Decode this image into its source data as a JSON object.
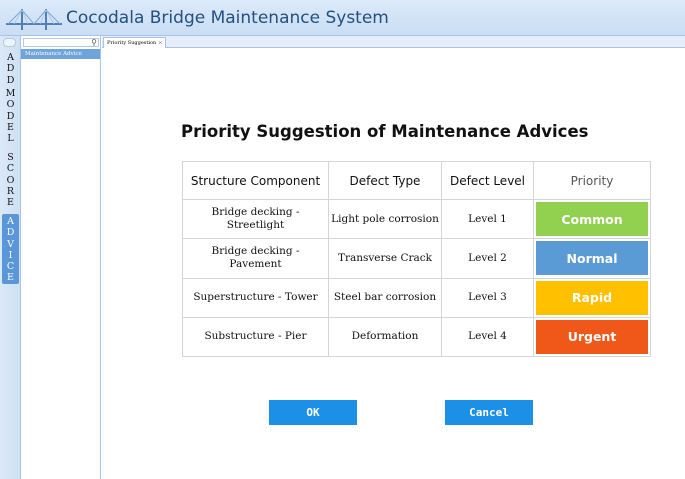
{
  "app": {
    "title": "Cocodala Bridge Maintenance System",
    "logo_icon": "bridge-logo-icon"
  },
  "nav": {
    "items": [
      {
        "label": "ADD",
        "active": false
      },
      {
        "label": "MODEL",
        "active": false
      },
      {
        "label": "SCORE",
        "active": false
      },
      {
        "label": "ADVICE",
        "active": true
      }
    ]
  },
  "tree": {
    "search_icon": "search-icon",
    "selected_item": "Maintenance Advice"
  },
  "tabs": [
    {
      "label": "Priority Suggestion",
      "close": "×"
    }
  ],
  "page": {
    "heading": "Priority Suggestion of Maintenance Advices"
  },
  "table": {
    "headers": [
      "Structure Component",
      "Defect Type",
      "Defect Level",
      "Priority"
    ],
    "rows": [
      {
        "component": "Bridge decking - Streetlight",
        "defect": "Light pole corrosion",
        "level": "Level 1",
        "priority": "Common",
        "color": "#92d050"
      },
      {
        "component": "Bridge decking - Pavement",
        "defect": "Transverse Crack",
        "level": "Level 2",
        "priority": "Normal",
        "color": "#5b9bd5"
      },
      {
        "component": "Superstructure - Tower",
        "defect": "Steel bar corrosion",
        "level": "Level 3",
        "priority": "Rapid",
        "color": "#ffc000"
      },
      {
        "component": "Substructure - Pier",
        "defect": "Deformation",
        "level": "Level 4",
        "priority": "Urgent",
        "color": "#f0581a"
      }
    ]
  },
  "buttons": {
    "ok": "OK",
    "cancel": "Cancel"
  },
  "colors": {
    "button": "#1c8fe6",
    "nav_active": "#5a97d9"
  }
}
